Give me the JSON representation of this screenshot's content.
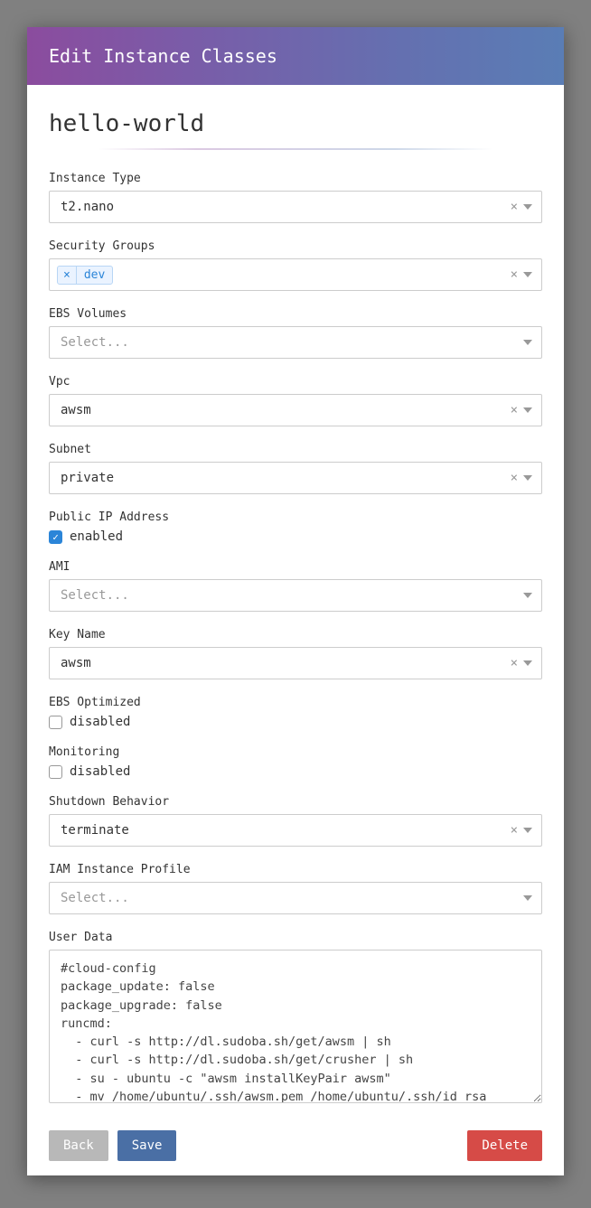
{
  "header": {
    "title": "Edit Instance Classes"
  },
  "page": {
    "title": "hello-world"
  },
  "fields": {
    "instanceType": {
      "label": "Instance Type",
      "value": "t2.nano",
      "clearable": true
    },
    "securityGroups": {
      "label": "Security Groups",
      "tags": [
        "dev"
      ],
      "clearable": true
    },
    "ebsVolumes": {
      "label": "EBS Volumes",
      "placeholder": "Select..."
    },
    "vpc": {
      "label": "Vpc",
      "value": "awsm",
      "clearable": true
    },
    "subnet": {
      "label": "Subnet",
      "value": "private",
      "clearable": true
    },
    "publicIp": {
      "label": "Public IP Address",
      "checked": true,
      "text": "enabled"
    },
    "ami": {
      "label": "AMI",
      "placeholder": "Select..."
    },
    "keyName": {
      "label": "Key Name",
      "value": "awsm",
      "clearable": true
    },
    "ebsOptimized": {
      "label": "EBS Optimized",
      "checked": false,
      "text": "disabled"
    },
    "monitoring": {
      "label": "Monitoring",
      "checked": false,
      "text": "disabled"
    },
    "shutdownBehavior": {
      "label": "Shutdown Behavior",
      "value": "terminate",
      "clearable": true
    },
    "iamProfile": {
      "label": "IAM Instance Profile",
      "placeholder": "Select..."
    },
    "userData": {
      "label": "User Data",
      "value": "#cloud-config\npackage_update: false\npackage_upgrade: false\nruncmd:\n  - curl -s http://dl.sudoba.sh/get/awsm | sh\n  - curl -s http://dl.sudoba.sh/get/crusher | sh\n  - su - ubuntu -c \"awsm installKeyPair awsm\"\n  - mv /home/ubuntu/.ssh/awsm.pem /home/ubuntu/.ssh/id_rsa"
    }
  },
  "buttons": {
    "back": "Back",
    "save": "Save",
    "delete": "Delete"
  }
}
